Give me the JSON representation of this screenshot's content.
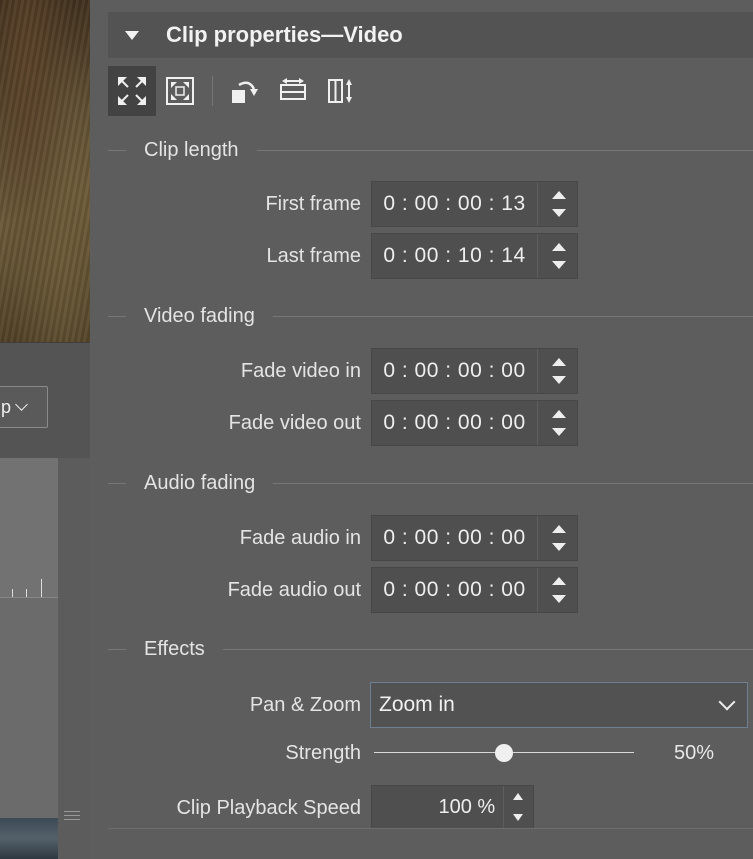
{
  "left": {
    "select_label": "p"
  },
  "panel": {
    "title": "Clip properties—Video"
  },
  "toolbar": {
    "buttons": [
      {
        "icon": "fullscreen-icon",
        "active": true
      },
      {
        "icon": "fit-frame-icon",
        "active": false
      },
      {
        "icon": "rotate-icon",
        "active": false
      },
      {
        "icon": "flip-horizontal-icon",
        "active": false
      },
      {
        "icon": "flip-vertical-icon",
        "active": false
      }
    ]
  },
  "sections": {
    "clip_length": "Clip length",
    "video_fading": "Video fading",
    "audio_fading": "Audio fading",
    "effects": "Effects"
  },
  "fields": {
    "first_frame": {
      "label": "First frame",
      "value": "0 : 00 : 00 : 13"
    },
    "last_frame": {
      "label": "Last frame",
      "value": "0 : 00 : 10 : 14"
    },
    "fade_video_in": {
      "label": "Fade video in",
      "value": "0 : 00 : 00 : 00"
    },
    "fade_video_out": {
      "label": "Fade video out",
      "value": "0 : 00 : 00 : 00"
    },
    "fade_audio_in": {
      "label": "Fade audio in",
      "value": "0 : 00 : 00 : 00"
    },
    "fade_audio_out": {
      "label": "Fade audio out",
      "value": "0 : 00 : 00 : 00"
    }
  },
  "effects": {
    "pan_zoom_label": "Pan & Zoom",
    "pan_zoom_value": "Zoom in",
    "strength_label": "Strength",
    "strength_value": 0.5,
    "strength_text": "50%",
    "speed_label": "Clip Playback Speed",
    "speed_value": "100 %"
  }
}
